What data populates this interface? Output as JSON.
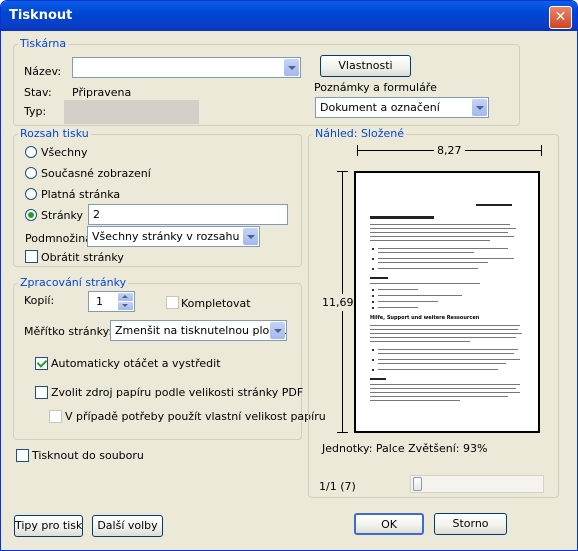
{
  "window": {
    "title": "Tisknout",
    "close_glyph": "✕"
  },
  "printer": {
    "group_label": "Tiskárna",
    "name_label": "Název:",
    "name_value": "",
    "status_label": "Stav:",
    "status_value": "Připravena",
    "type_label": "Typ:",
    "properties_button": "Vlastnosti",
    "comments_label": "Poznámky a formuláře",
    "comments_value": "Dokument a označení"
  },
  "range": {
    "group_label": "Rozsah tisku",
    "all": "Všechny",
    "current_view": "Současné zobrazení",
    "current_page": "Platná stránka",
    "pages": "Stránky",
    "pages_value": "2",
    "subset_label": "Podmnožina:",
    "subset_value": "Všechny stránky v rozsahu",
    "reverse": "Obrátit stránky",
    "selected": "pages"
  },
  "handling": {
    "group_label": "Zpracování stránky",
    "copies_label": "Kopií:",
    "copies_value": "1",
    "collate": "Kompletovat",
    "scaling_label": "Měřítko stránky:",
    "scaling_value": "Zmenšit na tisknutelnou plochu",
    "auto_rotate": "Automaticky otáčet a vystředit",
    "choose_paper": "Zvolit zdroj papíru podle velikosti stránky PDF",
    "custom_paper": "V případě potřeby použít vlastní velikost papíru",
    "auto_rotate_checked": true
  },
  "print_to_file": "Tisknout do souboru",
  "preview": {
    "group_label": "Náhled: Složené",
    "width": "8,27",
    "height": "11,69",
    "units": "Jednotky: Palce Zvětšení:  93%",
    "page_counter": "1/1 (7)",
    "doc_heading_1": "Hilfe, Support und weitere Ressourcen"
  },
  "buttons": {
    "tips": "Tipy pro tisk",
    "more": "Další volby",
    "ok": "OK",
    "cancel": "Storno"
  },
  "colors": {
    "accent": "#0046d5",
    "dialog_bg": "#ece9d8"
  }
}
